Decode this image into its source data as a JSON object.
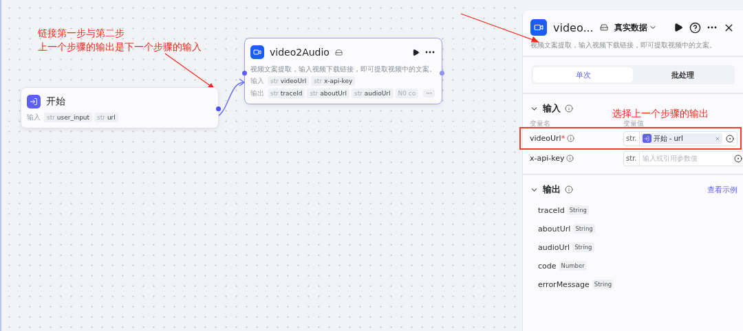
{
  "canvas": {
    "note": {
      "lines": [
        "链接第一步与第二步",
        "上一个步骤的输出是下一个步骤的输入"
      ]
    },
    "nodes": [
      {
        "kind": "start",
        "title": "开始",
        "rows": [
          {
            "label": "输入",
            "vars": [
              {
                "type": "str",
                "name": "user_input",
                "faded": false
              },
              {
                "type": "str",
                "name": "url",
                "faded": false
              }
            ]
          }
        ]
      },
      {
        "kind": "plugin",
        "title": "video2Audio",
        "description": "视频文案提取，输入视频下载链接，即可提取视频中的文案。",
        "more": "···",
        "rows": [
          {
            "label": "输入",
            "vars": [
              {
                "type": "str",
                "name": "videoUrl",
                "faded": false
              },
              {
                "type": "str",
                "name": "x-api-key",
                "faded": false
              }
            ]
          },
          {
            "label": "输出",
            "vars": [
              {
                "type": "str",
                "name": "traceId",
                "faded": false
              },
              {
                "type": "str",
                "name": "aboutUrl",
                "faded": false
              },
              {
                "type": "str",
                "name": "audioUrl",
                "faded": false
              },
              {
                "type": "N0",
                "name": "co",
                "faded": true
              }
            ]
          }
        ]
      }
    ]
  },
  "panel": {
    "title": "video...",
    "data_source": "真实数据",
    "description": "视频文案提取，输入视频下载链接，即可提取视频中的文案。",
    "tabs": [
      {
        "label": "单次",
        "selected": true
      },
      {
        "label": "批处理",
        "selected": false
      }
    ],
    "input": {
      "title": "输入",
      "expanded": true,
      "columns": [
        "变量名",
        "变量值"
      ],
      "note": "选择上一个步骤的输出",
      "params": [
        {
          "name": "videoUrl",
          "required_mark": "*",
          "highlighted": true,
          "type": "str.",
          "value": "开始 - url"
        },
        {
          "name": "x-api-key",
          "highlighted": false,
          "type": "str.",
          "placeholder": "输入或引用参数值"
        }
      ]
    },
    "output": {
      "title": "输出",
      "expanded": true,
      "link": "查看示例",
      "fields": [
        {
          "name": "traceId",
          "type": "String"
        },
        {
          "name": "aboutUrl",
          "type": "String"
        },
        {
          "name": "audioUrl",
          "type": "String"
        },
        {
          "name": "code",
          "type": "Number"
        },
        {
          "name": "errorMessage",
          "type": "String"
        }
      ]
    }
  }
}
